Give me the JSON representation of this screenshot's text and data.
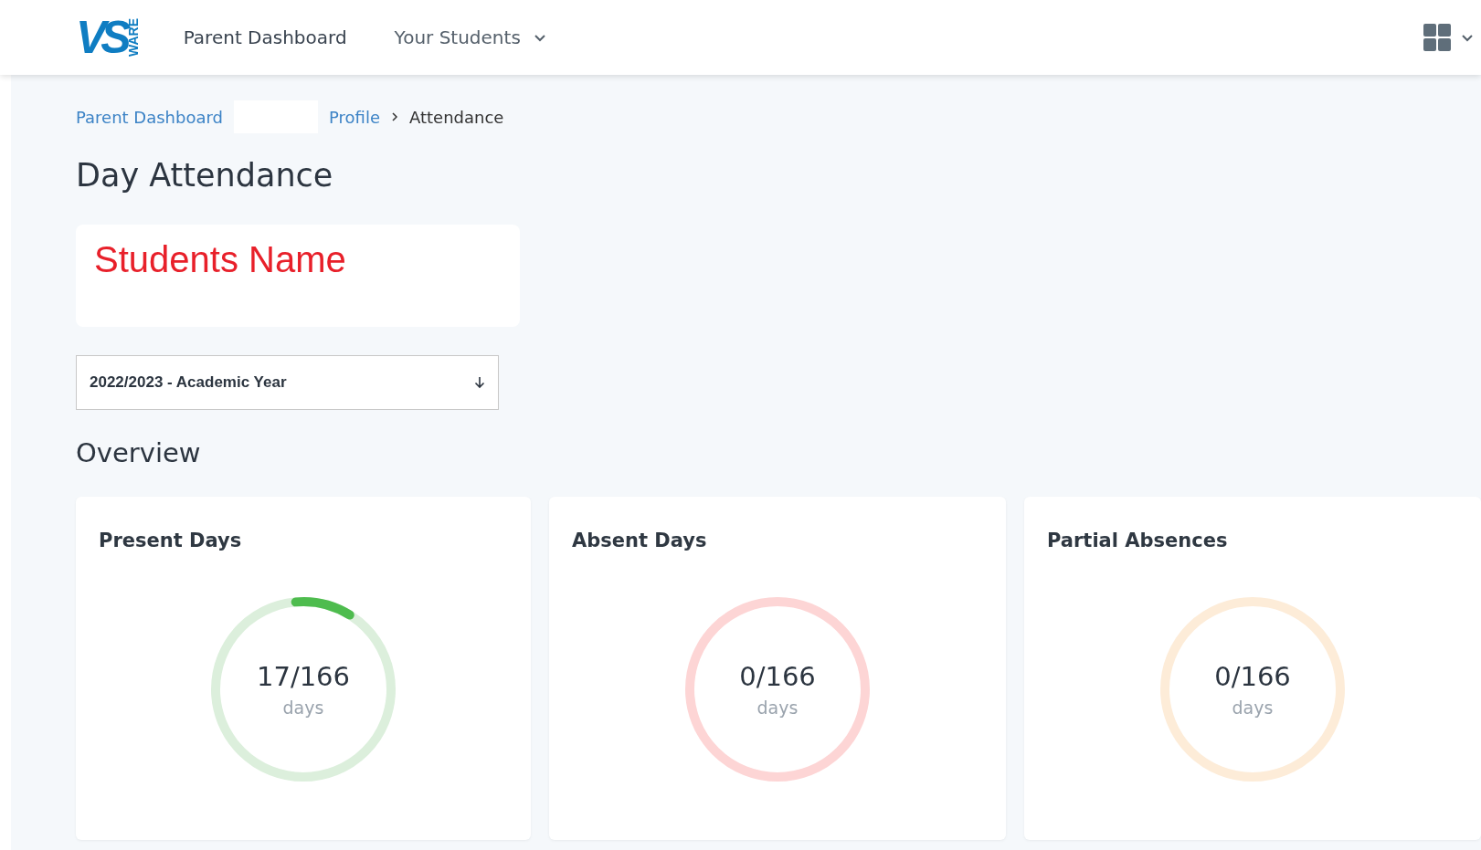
{
  "logo": {
    "mark": "VS",
    "sub": "WARE"
  },
  "nav": [
    {
      "label": "Parent Dashboard",
      "dropdown": false
    },
    {
      "label": "Your Students",
      "dropdown": true
    }
  ],
  "breadcrumb": [
    {
      "label": "Parent Dashboard",
      "kind": "link"
    },
    {
      "kind": "redacted"
    },
    {
      "label": "Profile",
      "kind": "link"
    },
    {
      "label": "Attendance",
      "kind": "current"
    }
  ],
  "page_title": "Day Attendance",
  "student_name": "Students Name",
  "year_select": {
    "value": "2022/2023 - Academic Year"
  },
  "section_title": "Overview",
  "cards": [
    {
      "title": "Present Days",
      "value": "17/166",
      "unit": "days",
      "color": "#dcefdc"
    },
    {
      "title": "Absent Days",
      "value": "0/166",
      "unit": "days",
      "color": "#fdd5d5"
    },
    {
      "title": "Partial Absences",
      "value": "0/166",
      "unit": "days",
      "color": "#fdecd8"
    }
  ]
}
